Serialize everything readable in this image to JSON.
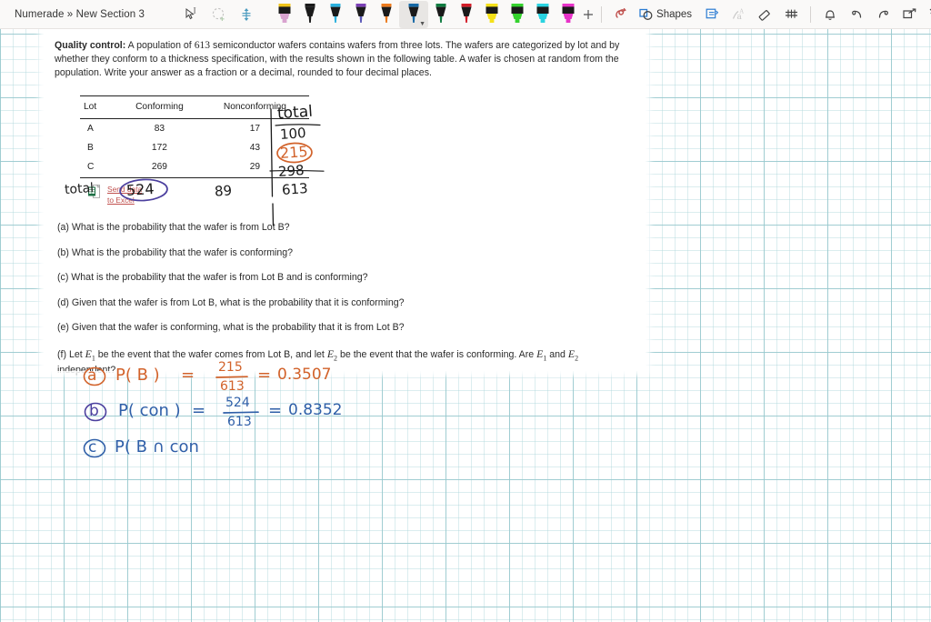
{
  "app": {
    "breadcrumb": "Numerade » New Section 3"
  },
  "toolbar": {
    "left_tools": [
      {
        "name": "select-lasso-text-tool",
        "label": "Select"
      },
      {
        "name": "lasso-select-tool",
        "label": "Lasso Select"
      },
      {
        "name": "pan-move-tool",
        "label": "Pan"
      }
    ],
    "pens": [
      {
        "name": "pen-eraser-pink",
        "cap": "#1a1a1a",
        "barrel": "#f0c419",
        "tip": "#d9a3cf",
        "type": "highlighter",
        "selected": false
      },
      {
        "name": "pen-black",
        "cap": "#1a1a1a",
        "barrel": "#1a1a1a",
        "tip": "#1a1a1a",
        "type": "pen",
        "selected": false
      },
      {
        "name": "pen-cyan",
        "cap": "#1a1a1a",
        "barrel": "#2ab0dd",
        "tip": "#2ab0dd",
        "type": "pen",
        "selected": false
      },
      {
        "name": "pen-purple",
        "cap": "#1a1a1a",
        "barrel": "#7b3fb5",
        "tip": "#5a57b8",
        "type": "pen",
        "selected": false
      },
      {
        "name": "pen-orange",
        "cap": "#1a1a1a",
        "barrel": "#ec7a1c",
        "tip": "#ec7a1c",
        "type": "pen",
        "selected": false
      },
      {
        "name": "pen-blue",
        "cap": "#1a1a1a",
        "barrel": "#1568a5",
        "tip": "#1568a5",
        "type": "pen",
        "selected": true
      },
      {
        "name": "pen-green",
        "cap": "#1a1a1a",
        "barrel": "#107c41",
        "tip": "#107c41",
        "type": "pen",
        "selected": false
      },
      {
        "name": "pen-red",
        "cap": "#1a1a1a",
        "barrel": "#d31d28",
        "tip": "#d31d28",
        "type": "pen",
        "selected": false
      },
      {
        "name": "highlighter-yellow",
        "cap": "#1a1a1a",
        "barrel": "#f5e119",
        "tip": "#f5e119",
        "type": "highlighter",
        "selected": false
      },
      {
        "name": "highlighter-green",
        "cap": "#1a1a1a",
        "barrel": "#35d22e",
        "tip": "#35d22e",
        "type": "highlighter",
        "selected": false
      },
      {
        "name": "highlighter-cyan",
        "cap": "#1a1a1a",
        "barrel": "#2ad3e0",
        "tip": "#2ad3e0",
        "type": "highlighter",
        "selected": false
      },
      {
        "name": "highlighter-magenta",
        "cap": "#1a1a1a",
        "barrel": "#e832c8",
        "tip": "#e832c8",
        "type": "highlighter",
        "selected": false
      }
    ],
    "add_pen_label": "+",
    "shapes_label": "Shapes",
    "right_tools": [
      {
        "name": "ink-to-shape-tool",
        "label": "Ink to Shape"
      },
      {
        "name": "shapes-button",
        "label": "Shapes"
      },
      {
        "name": "insert-space-tool",
        "label": "Insert Space"
      },
      {
        "name": "ink-to-text-tool",
        "label": "Ink to Text"
      },
      {
        "name": "eraser-tool",
        "label": "Eraser"
      },
      {
        "name": "ruler-tool",
        "label": "Ruler"
      },
      {
        "name": "reminder-bell",
        "label": "Reminder"
      },
      {
        "name": "undo-button",
        "label": "Undo"
      },
      {
        "name": "redo-button",
        "label": "Redo"
      },
      {
        "name": "share-button",
        "label": "Share"
      },
      {
        "name": "collapse-ribbon-button",
        "label": "Collapse"
      }
    ]
  },
  "problem": {
    "title": "Quality control:",
    "intro_part1": " A population of ",
    "population": "613",
    "intro_part2": " semiconductor wafers contains wafers from three lots. The wafers are categorized by lot and by whether they conform to a thickness specification, with the results shown in the following table. A wafer is chosen at random from the population. Write your answer as a fraction or a decimal, rounded to four decimal places.",
    "table": {
      "headers": [
        "Lot",
        "Conforming",
        "Nonconforming"
      ],
      "rows": [
        {
          "lot": "A",
          "conforming": "83",
          "nonconforming": "17"
        },
        {
          "lot": "B",
          "conforming": "172",
          "nonconforming": "43"
        },
        {
          "lot": "C",
          "conforming": "269",
          "nonconforming": "29"
        }
      ]
    },
    "send_data": {
      "line1": "Send data",
      "line2": "to Excel"
    },
    "questions": [
      {
        "id": "a",
        "text": "(a) What is the probability that the wafer is from Lot B?"
      },
      {
        "id": "b",
        "text": "(b) What is the probability that the wafer is conforming?"
      },
      {
        "id": "c",
        "text": "(c) What is the probability that the wafer is from Lot B and is conforming?"
      },
      {
        "id": "d",
        "text": "(d) Given that the wafer is from Lot B, what is the probability that it is conforming?"
      },
      {
        "id": "e",
        "text": "(e) Given that the wafer is conforming, what is the probability that it is from Lot B?"
      }
    ],
    "question_f": {
      "seg1": "(f) Let ",
      "e1": "E",
      "e1sub": "1",
      "seg2": " be the event that the wafer comes from Lot B, and let ",
      "e2": "E",
      "e2sub": "2",
      "seg3": " be the event that the wafer is conforming. Are ",
      "e3": "E",
      "e3sub": "1",
      "seg4": " and ",
      "e4": "E",
      "e4sub": "2",
      "seg5": "independent?"
    }
  },
  "annotations": {
    "table_total_header": "total",
    "row_totals": [
      "100",
      "215",
      "298"
    ],
    "grand_total": "613",
    "bottom_total_label": "total",
    "conforming_total": "524",
    "nonconforming_total": "89",
    "circled_row_total": "215",
    "circled_conforming_total": "524"
  },
  "work": {
    "lines": [
      {
        "label": "a",
        "expr": "P( B )",
        "equals1": "=",
        "numerator": "215",
        "denominator": "613",
        "equals2": "=",
        "result": "0.3507",
        "color": "#d2622a"
      },
      {
        "label": "b",
        "expr": "P( con )",
        "equals1": "=",
        "numerator": "524",
        "denominator": "613",
        "equals2": "=",
        "result": "0.8352",
        "color": "#2f5fa8"
      },
      {
        "label": "c",
        "expr": "P( B ∩ con",
        "equals1": "",
        "numerator": "",
        "denominator": "",
        "equals2": "",
        "result": "",
        "color": "#2f5fa8"
      }
    ]
  },
  "colors": {
    "toolbar_bg": "#faf9f8",
    "grid_major": "#96c8cd",
    "grid_minor": "#afd7dc",
    "ink_orange": "#d2622a",
    "ink_blue": "#2f5fa8",
    "ink_purple": "#4b3f9e",
    "ink_black": "#1a1a1a",
    "excel_link": "#c0504d"
  }
}
